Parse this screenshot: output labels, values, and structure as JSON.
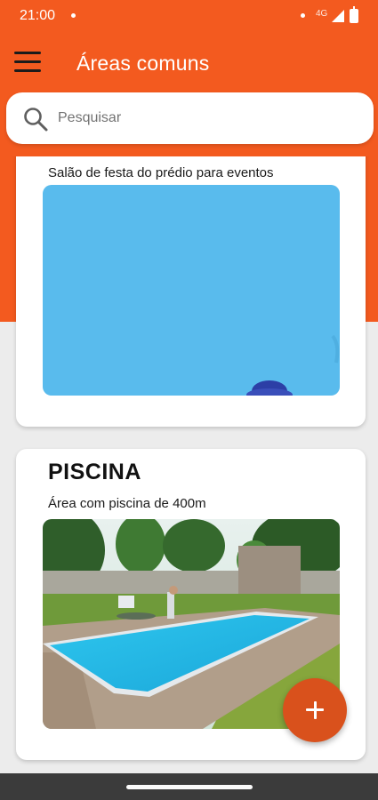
{
  "status_bar": {
    "time": "21:00",
    "network": "4G"
  },
  "app_bar": {
    "title": "Áreas comuns"
  },
  "search": {
    "placeholder": "Pesquisar",
    "value": ""
  },
  "areas": [
    {
      "title": "",
      "description": "Salão de festa do prédio para eventos"
    },
    {
      "title": "PISCINA",
      "description": "Área com piscina de 400m"
    }
  ],
  "fab": {
    "icon": "plus-icon"
  },
  "colors": {
    "primary": "#f35a1f",
    "fab": "#d9511c",
    "background": "#ececec"
  }
}
